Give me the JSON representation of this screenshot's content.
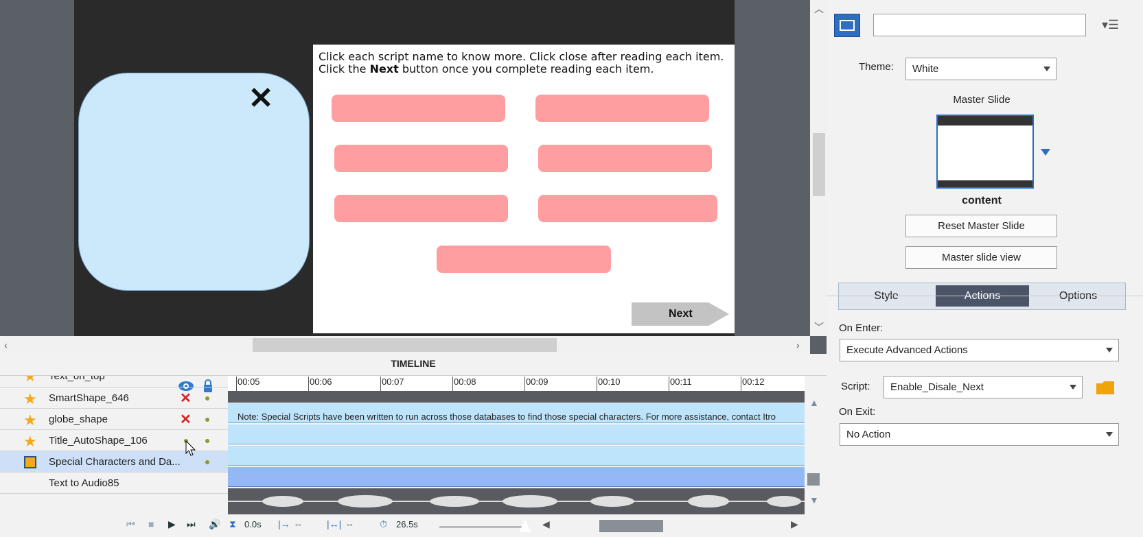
{
  "stage": {
    "instruction_line1": "Click each script name to know more. Click close after reading each item.",
    "instruction_line2_pre": "Click the ",
    "instruction_line2_bold": "Next",
    "instruction_line2_post": " button once you complete reading each item.",
    "close_glyph": "✕",
    "next_label": "Next"
  },
  "timeline": {
    "title": "TIMELINE",
    "ticks": [
      "00:05",
      "00:06",
      "00:07",
      "00:08",
      "00:09",
      "00:10",
      "00:11",
      "00:12"
    ],
    "layers": [
      {
        "label": "Text_on_top"
      },
      {
        "label": "SmartShape_646"
      },
      {
        "label": "globe_shape"
      },
      {
        "label": "Title_AutoShape_106"
      },
      {
        "label": "Special Characters and Da..."
      },
      {
        "label": "Text to Audio85"
      }
    ],
    "note_text": "Note: Special Scripts have been written to run across those databases to find those special characters. For more assistance, contact Itro",
    "controls": {
      "time": "0.0s",
      "start": "--",
      "end": "--",
      "duration": "26.5s"
    }
  },
  "properties": {
    "name_value": "",
    "theme_label": "Theme:",
    "theme_value": "White",
    "master_slide_label": "Master Slide",
    "master_name": "content",
    "reset_button": "Reset Master Slide",
    "view_button": "Master slide view",
    "tabs": [
      "Style",
      "Actions",
      "Options"
    ],
    "active_tab": "Actions",
    "on_enter_label": "On Enter:",
    "on_enter_value": "Execute Advanced Actions",
    "script_label": "Script:",
    "script_value": "Enable_Disale_Next",
    "on_exit_label": "On Exit:",
    "on_exit_value": "No Action"
  },
  "colors": {
    "pill": "#ff9ea0",
    "bubble": "#cce8fb",
    "accent": "#4b5567",
    "track_light": "#bde4fa",
    "track_selected": "#94b8f6"
  }
}
